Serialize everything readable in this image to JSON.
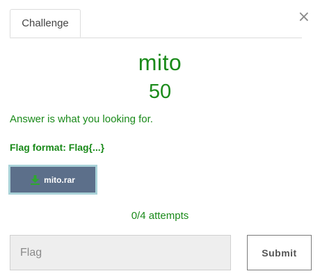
{
  "modal": {
    "close_glyph": "×",
    "tabs": [
      {
        "label": "Challenge",
        "active": true
      }
    ],
    "challenge": {
      "name": "mito",
      "value": "50",
      "description": "Answer is what you looking for.",
      "flag_format": "Flag format: Flag{...}"
    },
    "file": {
      "name": "mito.rar",
      "icon": "download-icon"
    },
    "attempts": "0/4 attempts",
    "flag_input": {
      "placeholder": "Flag",
      "value": ""
    },
    "submit_label": "Submit"
  },
  "colors": {
    "accent_green": "#1a8a1a",
    "file_button_bg": "#5c6f8a",
    "file_button_border": "#a9d2d8",
    "download_icon": "#2ea82e"
  }
}
